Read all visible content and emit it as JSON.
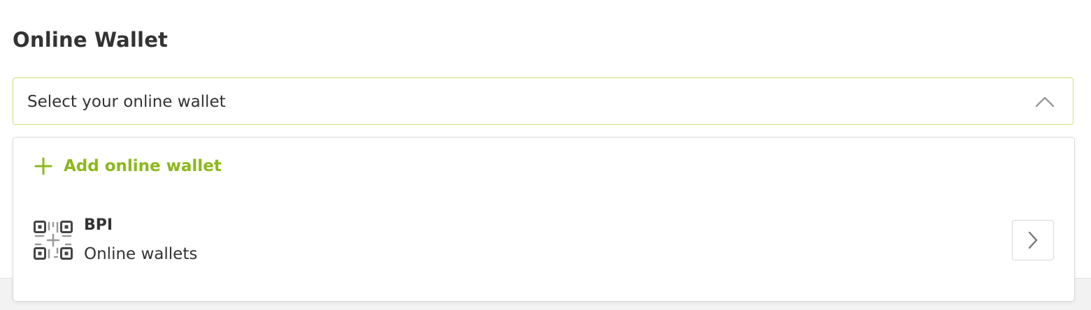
{
  "page": {
    "title": "Online Wallet"
  },
  "select": {
    "placeholder": "Select your online wallet",
    "expanded": true,
    "chevron_icon": "chevron-up-icon"
  },
  "dropdown": {
    "add_wallet": {
      "label": "Add online wallet",
      "icon": "plus-icon"
    },
    "items": [
      {
        "name": "BPI",
        "type": "Online wallets",
        "icon": "qr-code-icon",
        "action_icon": "chevron-right-icon"
      }
    ]
  },
  "colors": {
    "accent": "#8cb81c",
    "select_border": "#c9e37a",
    "text": "#333333",
    "border": "#d9d9d9",
    "icon_gray": "#555555"
  }
}
